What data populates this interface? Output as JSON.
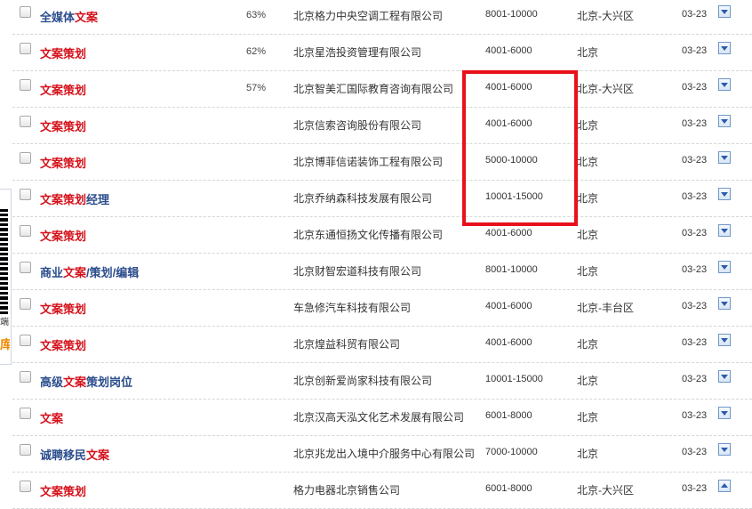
{
  "side_panel": {
    "text_line1": "端",
    "text_line2": "库"
  },
  "rows": [
    {
      "title_parts": [
        {
          "t": "全媒体",
          "hl": false
        },
        {
          "t": "文案",
          "hl": true
        }
      ],
      "pct": "63%",
      "company": "北京格力中央空调工程有限公司",
      "salary": "8001-10000",
      "location": "北京-大兴区",
      "date": "03-23",
      "expand": "down"
    },
    {
      "title_parts": [
        {
          "t": "文案策划",
          "hl": true
        }
      ],
      "pct": "62%",
      "company": "北京星浩投资管理有限公司",
      "salary": "4001-6000",
      "location": "北京",
      "date": "03-23",
      "expand": "down"
    },
    {
      "title_parts": [
        {
          "t": "文案策划",
          "hl": true
        }
      ],
      "pct": "57%",
      "company": "北京智美汇国际教育咨询有限公司",
      "salary": "4001-6000",
      "location": "北京-大兴区",
      "date": "03-23",
      "expand": "down"
    },
    {
      "title_parts": [
        {
          "t": "文案策划",
          "hl": true
        }
      ],
      "pct": "",
      "company": "北京信索咨询股份有限公司",
      "salary": "4001-6000",
      "location": "北京",
      "date": "03-23",
      "expand": "down"
    },
    {
      "title_parts": [
        {
          "t": "文案策划",
          "hl": true
        }
      ],
      "pct": "",
      "company": "北京博菲信诺装饰工程有限公司",
      "salary": "5000-10000",
      "location": "北京",
      "date": "03-23",
      "expand": "down"
    },
    {
      "title_parts": [
        {
          "t": "文案策划",
          "hl": true
        },
        {
          "t": "经理",
          "hl": false
        }
      ],
      "pct": "",
      "company": "北京乔纳森科技发展有限公司",
      "salary": "10001-15000",
      "location": "北京",
      "date": "03-23",
      "expand": "down"
    },
    {
      "title_parts": [
        {
          "t": "文案策划",
          "hl": true
        }
      ],
      "pct": "",
      "company": "北京东通恒扬文化传播有限公司",
      "salary": "4001-6000",
      "location": "北京",
      "date": "03-23",
      "expand": "down"
    },
    {
      "title_parts": [
        {
          "t": "商业",
          "hl": false
        },
        {
          "t": "文案",
          "hl": true
        },
        {
          "t": "/策划/编辑",
          "hl": false
        }
      ],
      "pct": "",
      "company": "北京财智宏道科技有限公司",
      "salary": "8001-10000",
      "location": "北京",
      "date": "03-23",
      "expand": "down"
    },
    {
      "title_parts": [
        {
          "t": "文案策划",
          "hl": true
        }
      ],
      "pct": "",
      "company": "车急修汽车科技有限公司",
      "salary": "4001-6000",
      "location": "北京-丰台区",
      "date": "03-23",
      "expand": "down"
    },
    {
      "title_parts": [
        {
          "t": "文案策划",
          "hl": true
        }
      ],
      "pct": "",
      "company": "北京煌益科贸有限公司",
      "salary": "4001-6000",
      "location": "北京",
      "date": "03-23",
      "expand": "down"
    },
    {
      "title_parts": [
        {
          "t": "高级",
          "hl": false
        },
        {
          "t": "文案",
          "hl": true
        },
        {
          "t": "策划岗位",
          "hl": false
        }
      ],
      "pct": "",
      "company": "北京创新爱尚家科技有限公司",
      "salary": "10001-15000",
      "location": "北京",
      "date": "03-23",
      "expand": "down"
    },
    {
      "title_parts": [
        {
          "t": "文案",
          "hl": true
        }
      ],
      "pct": "",
      "company": "北京汉高天泓文化艺术发展有限公司",
      "salary": "6001-8000",
      "location": "北京",
      "date": "03-23",
      "expand": "down"
    },
    {
      "title_parts": [
        {
          "t": "诚聘移民",
          "hl": false
        },
        {
          "t": "文案",
          "hl": true
        }
      ],
      "pct": "",
      "company": "北京兆龙出入境中介服务中心有限公司",
      "salary": "7000-10000",
      "location": "北京",
      "date": "03-23",
      "expand": "down"
    },
    {
      "title_parts": [
        {
          "t": "文案策划",
          "hl": true
        }
      ],
      "pct": "",
      "company": "格力电器北京销售公司",
      "salary": "6001-8000",
      "location": "北京-大兴区",
      "date": "03-23",
      "expand": "up"
    }
  ]
}
